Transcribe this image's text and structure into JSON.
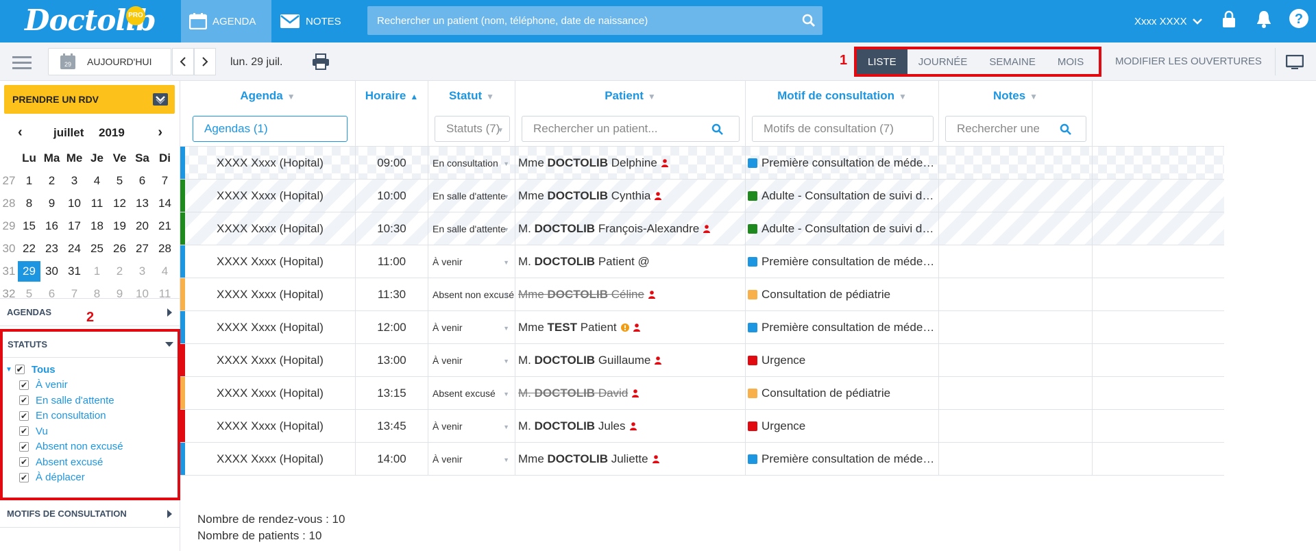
{
  "app": {
    "logo": "Doctolib",
    "pro_badge": "PRO"
  },
  "topbar": {
    "nav": [
      {
        "label": "AGENDA",
        "icon": "calendar-icon"
      },
      {
        "label": "NOTES",
        "icon": "envelope-icon"
      }
    ],
    "search_placeholder": "Rechercher un patient (nom, téléphone, date de naissance)",
    "user": "Xxxx XXXX"
  },
  "toolbar": {
    "today": "AUJOURD'HUI",
    "today_day": "29",
    "current_date": "lun. 29 juil.",
    "views": [
      "LISTE",
      "JOURNÉE",
      "SEMAINE",
      "MOIS"
    ],
    "active_view": "LISTE",
    "modify": "MODIFIER LES OUVERTURES",
    "annotation": "1"
  },
  "sidebar": {
    "rdv_button": "PRENDRE UN RDV",
    "calendar": {
      "month": "juillet",
      "year": "2019",
      "weekdays": [
        "Lu",
        "Ma",
        "Me",
        "Je",
        "Ve",
        "Sa",
        "Di"
      ],
      "weeks": [
        {
          "wk": "27",
          "days": [
            "1",
            "2",
            "3",
            "4",
            "5",
            "6",
            "7"
          ]
        },
        {
          "wk": "28",
          "days": [
            "8",
            "9",
            "10",
            "11",
            "12",
            "13",
            "14"
          ]
        },
        {
          "wk": "29",
          "days": [
            "15",
            "16",
            "17",
            "18",
            "19",
            "20",
            "21"
          ]
        },
        {
          "wk": "30",
          "days": [
            "22",
            "23",
            "24",
            "25",
            "26",
            "27",
            "28"
          ]
        },
        {
          "wk": "31",
          "days": [
            "29",
            "30",
            "31",
            "1",
            "2",
            "3",
            "4"
          ]
        },
        {
          "wk": "32",
          "days": [
            "5",
            "6",
            "7",
            "8",
            "9",
            "10",
            "11"
          ]
        }
      ],
      "selected": "29"
    },
    "sections": {
      "agendas": "AGENDAS",
      "statuts": "STATUTS",
      "motifs": "MOTIFS DE CONSULTATION"
    },
    "annotation": "2",
    "statuses": {
      "all": "Tous",
      "items": [
        "À venir",
        "En salle d'attente",
        "En consultation",
        "Vu",
        "Absent non excusé",
        "Absent excusé",
        "À déplacer"
      ]
    }
  },
  "table": {
    "columns": {
      "agenda": "Agenda",
      "horaire": "Horaire",
      "statut": "Statut",
      "patient": "Patient",
      "motif": "Motif de consultation",
      "notes": "Notes"
    },
    "filters": {
      "agenda": "Agendas (1)",
      "statut": "Statuts (7)",
      "patient": "Rechercher un patient...",
      "motif": "Motifs de consultation (7)",
      "notes": "Rechercher une note"
    },
    "colors": {
      "blue": "#1d96e2",
      "green": "#1e8a1e",
      "orange": "#f7b04a",
      "red": "#e10a10"
    },
    "rows": [
      {
        "agenda": "XXXX Xxxx (Hopital)",
        "time": "09:00",
        "status": "En consultation",
        "title": "Mme",
        "last": "DOCTOLIB",
        "first": "Delphine",
        "motif": "Première consultation de médecine gén…",
        "color": "blue",
        "style": "check",
        "person": true
      },
      {
        "agenda": "XXXX Xxxx (Hopital)",
        "time": "10:00",
        "status": "En salle d'attente",
        "title": "Mme",
        "last": "DOCTOLIB",
        "first": "Cynthia",
        "motif": "Adulte - Consultation de suivi de médec…",
        "color": "green",
        "style": "hatch",
        "person": true
      },
      {
        "agenda": "XXXX Xxxx (Hopital)",
        "time": "10:30",
        "status": "En salle d'attente",
        "title": "M.",
        "last": "DOCTOLIB",
        "first": "François-Alexandre",
        "motif": "Adulte - Consultation de suivi de médec…",
        "color": "green",
        "style": "hatch",
        "person": true
      },
      {
        "agenda": "XXXX Xxxx (Hopital)",
        "time": "11:00",
        "status": "À venir",
        "title": "M.",
        "last": "DOCTOLIB",
        "first": "Patient @",
        "motif": "Première consultation de médecine gén…",
        "color": "blue",
        "style": "plain",
        "person": false
      },
      {
        "agenda": "XXXX Xxxx (Hopital)",
        "time": "11:30",
        "status": "Absent non excusé",
        "title": "Mme",
        "last": "DOCTOLIB",
        "first": "Céline",
        "motif": "Consultation de pédiatrie",
        "color": "orange",
        "style": "plain",
        "person": true,
        "strike": true
      },
      {
        "agenda": "XXXX Xxxx (Hopital)",
        "time": "12:00",
        "status": "À venir",
        "title": "Mme",
        "last": "TEST",
        "first": "Patient",
        "motif": "Première consultation de médecine gén…",
        "color": "blue",
        "style": "plain",
        "person": true,
        "alert": true
      },
      {
        "agenda": "XXXX Xxxx (Hopital)",
        "time": "13:00",
        "status": "À venir",
        "title": "M.",
        "last": "DOCTOLIB",
        "first": "Guillaume",
        "motif": "Urgence",
        "color": "red",
        "style": "plain",
        "person": true
      },
      {
        "agenda": "XXXX Xxxx (Hopital)",
        "time": "13:15",
        "status": "Absent excusé",
        "title": "M.",
        "last": "DOCTOLIB",
        "first": "David",
        "motif": "Consultation de pédiatrie",
        "color": "orange",
        "style": "plain",
        "person": true,
        "strike": true
      },
      {
        "agenda": "XXXX Xxxx (Hopital)",
        "time": "13:45",
        "status": "À venir",
        "title": "M.",
        "last": "DOCTOLIB",
        "first": "Jules",
        "motif": "Urgence",
        "color": "red",
        "style": "plain",
        "person": true
      },
      {
        "agenda": "XXXX Xxxx (Hopital)",
        "time": "14:00",
        "status": "À venir",
        "title": "Mme",
        "last": "DOCTOLIB",
        "first": "Juliette",
        "motif": "Première consultation de médecine gén…",
        "color": "blue",
        "style": "plain",
        "person": true
      }
    ]
  },
  "summary": {
    "appointments": "Nombre de rendez-vous : 10",
    "patients": "Nombre de patients : 10"
  }
}
